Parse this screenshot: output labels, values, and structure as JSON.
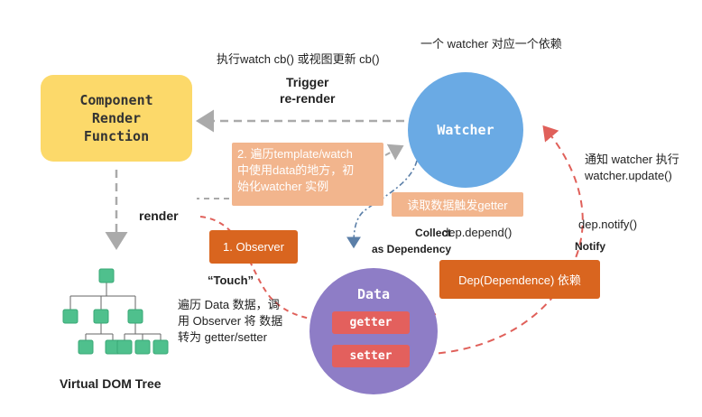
{
  "nodes": {
    "component": "Component\nRender\nFunction",
    "watcher": "Watcher",
    "data": "Data",
    "getter": "getter",
    "setter": "setter",
    "virtual_dom": "Virtual DOM Tree"
  },
  "boxes": {
    "observer": "1. Observer",
    "dep": "Dep(Dependence) 依赖",
    "traverse": "2. 遍历template/watch\n中使用data的地方，初\n始化watcher 实例",
    "read_getter": "读取数据触发getter"
  },
  "labels": {
    "watcher_note": "一个 watcher 对应一个依赖",
    "exec_cb": "执行watch cb() 或视图更新 cb()",
    "trigger": "Trigger\nre-render",
    "render": "render",
    "touch": "“Touch”",
    "traverse_data": "遍历 Data 数据，调\n用 Observer 将 数据\n转为 getter/setter",
    "collect": "Collect\nas Dependency",
    "dep_depend": "dep.depend()",
    "notify_watcher": "通知 watcher 执行\nwatcher.update()",
    "dep_notify": "dep.notify()",
    "notify": "Notify"
  },
  "colors": {
    "component": "#fcd96a",
    "watcher": "#6aaae4",
    "data": "#8e7dc6",
    "pill": "#e3605d",
    "orange": "#d9651f",
    "peach": "#f2b58d",
    "tree": "#4fc08d",
    "arrow_gray": "#aaaaaa",
    "arrow_red": "#e0605a",
    "arrow_blue": "#5b7fa8"
  }
}
